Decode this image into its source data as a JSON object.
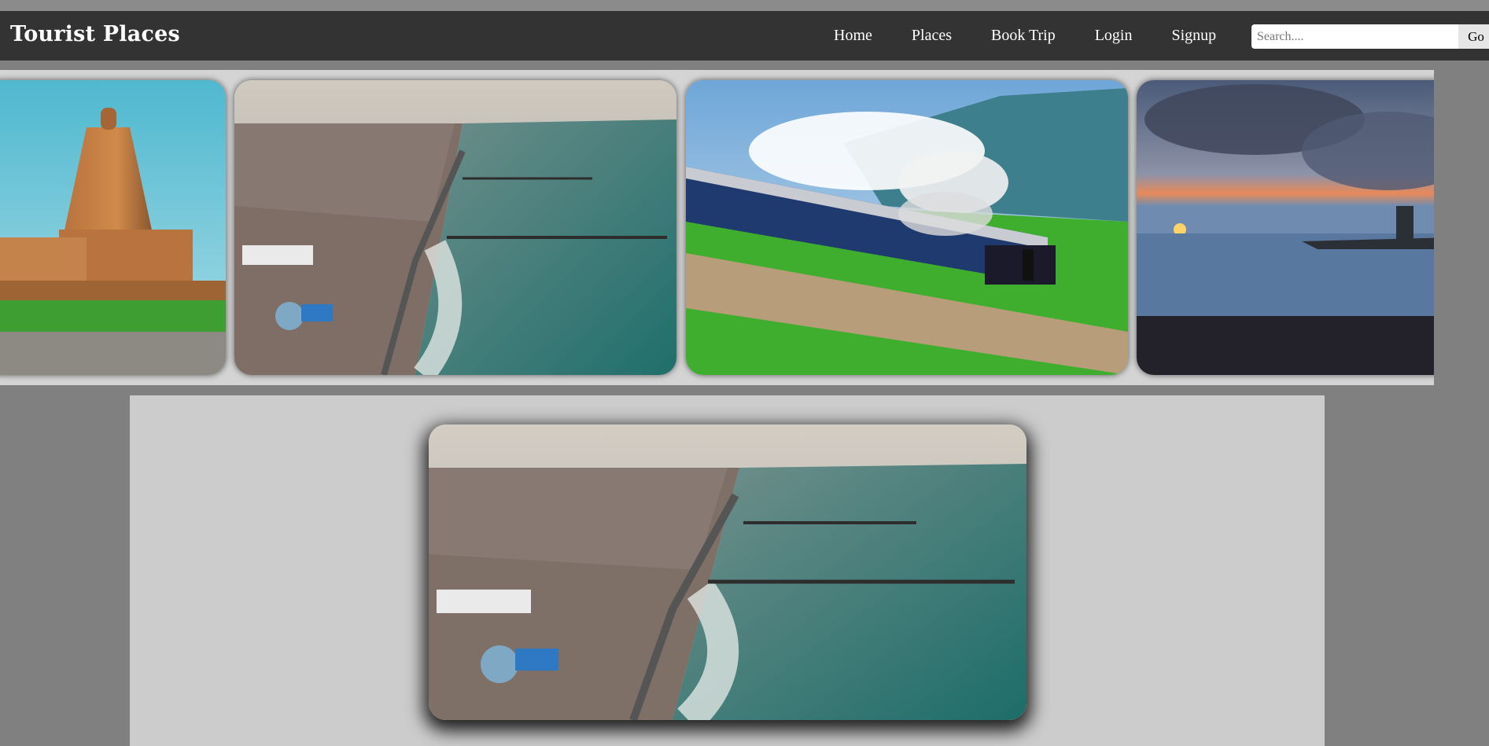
{
  "navbar": {
    "brand": "Tourist Places",
    "links": [
      "Home",
      "Places",
      "Book Trip",
      "Login",
      "Signup"
    ],
    "search_placeholder": "Search....",
    "go_label": "Go"
  },
  "gallery": {
    "images": [
      {
        "subject": "temple-photo"
      },
      {
        "subject": "coastal-city-aerial-photo"
      },
      {
        "subject": "mountain-train-photo"
      },
      {
        "subject": "seaside-sunset-crowd-photo"
      }
    ]
  },
  "featured": {
    "subject": "coastal-city-aerial-photo"
  },
  "colors": {
    "navbar_bg": "#333333",
    "page_bg": "#808080",
    "panel_bg": "#cccccc",
    "strip_bg": "#d4d4d4"
  }
}
